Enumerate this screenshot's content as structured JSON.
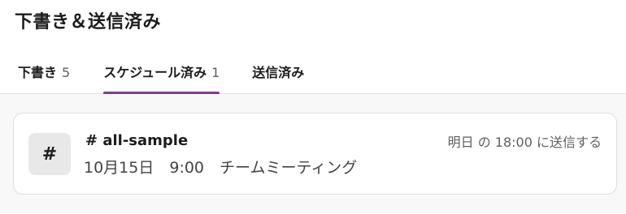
{
  "header": {
    "title": "下書き＆送信済み"
  },
  "tabs": [
    {
      "label": "下書き",
      "count": "5"
    },
    {
      "label": "スケジュール済み",
      "count": "1"
    },
    {
      "label": "送信済み",
      "count": ""
    }
  ],
  "scheduled_item": {
    "avatar_symbol": "#",
    "channel": "# all-sample",
    "message": "10月15日　9:00　チームミーティング",
    "schedule": "明日 の 18:00 に送信する"
  },
  "colors": {
    "accent": "#7c3f8c",
    "background_muted": "#f8f8f8"
  }
}
